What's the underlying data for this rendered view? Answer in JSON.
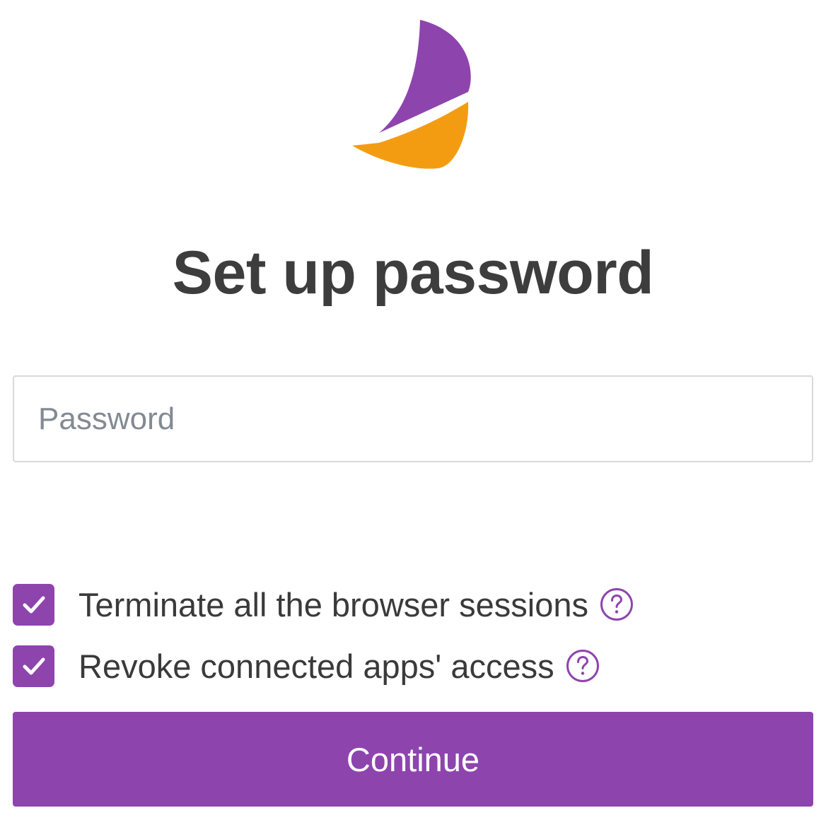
{
  "colors": {
    "accent": "#8e44ad",
    "logo_orange": "#f39c12",
    "text": "#3a3a3a",
    "input_border": "#d9d9d9"
  },
  "logo": {
    "icon": "sailboat-logo"
  },
  "page": {
    "title": "Set up password"
  },
  "form": {
    "password": {
      "placeholder": "Password",
      "value": ""
    },
    "options": [
      {
        "label": "Terminate all the browser sessions",
        "checked": true,
        "help_icon": "question-circle-icon"
      },
      {
        "label": "Revoke connected apps' access",
        "checked": true,
        "help_icon": "question-circle-icon"
      }
    ],
    "submit_label": "Continue"
  }
}
